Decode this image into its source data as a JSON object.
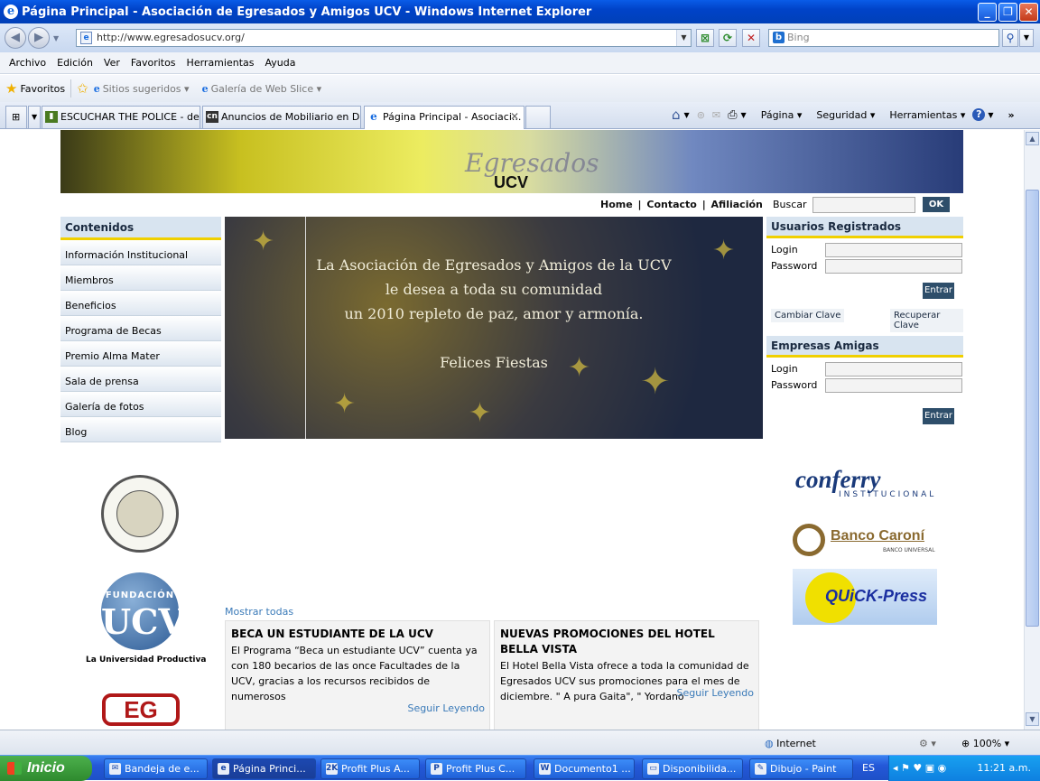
{
  "window": {
    "title": "Página Principal - Asociación de Egresados y Amigos UCV - Windows Internet Explorer"
  },
  "address": {
    "url": "http://www.egresadosucv.org/",
    "search_placeholder": "Bing"
  },
  "menu": [
    "Archivo",
    "Edición",
    "Ver",
    "Favoritos",
    "Herramientas",
    "Ayuda"
  ],
  "favorites": {
    "label": "Favoritos",
    "suggested": "Sitios sugeridos",
    "webslice": "Galería de Web Slice"
  },
  "tabs": [
    {
      "label": "ESCUCHAR THE POLICE - de ..."
    },
    {
      "label": "Anuncios de Mobiliario en Dis..."
    },
    {
      "label": "Página Principal - Asociaci..."
    }
  ],
  "commands": [
    "Página",
    "Seguridad",
    "Herramientas"
  ],
  "banner": {
    "logo_script": "Egresados",
    "logo_text": "UCV"
  },
  "toplinks": [
    "Home",
    "Contacto",
    "Afiliación"
  ],
  "search": {
    "label": "Buscar",
    "button": "OK"
  },
  "sidebar": {
    "title": "Contenidos",
    "items": [
      "Información Institucional",
      "Miembros",
      "Beneficios",
      "Programa de Becas",
      "Premio Alma Mater",
      "Sala de prensa",
      "Galería de fotos",
      "Blog"
    ]
  },
  "hero": {
    "lines": [
      "La Asociación de Egresados y Amigos de la UCV",
      "le desea a toda su comunidad",
      "un 2010 repleto de paz, amor y armonía."
    ],
    "closing": "Felices Fiestas"
  },
  "usuarios": {
    "title": "Usuarios Registrados",
    "login": "Login",
    "password": "Password",
    "button": "Entrar",
    "change": "Cambiar Clave",
    "recover": "Recuperar Clave"
  },
  "empresas": {
    "title": "Empresas Amigas",
    "login": "Login",
    "password": "Password",
    "button": "Entrar"
  },
  "logos": {
    "fundacion_top": "FUNDACIÓN",
    "fundacion_main": "UCV",
    "fundacion_caption": "La Universidad Productiva",
    "eg": "EG",
    "conferry": "conferry",
    "conferry_sub": "INSTITUCIONAL",
    "caroni": "Banco Caroní",
    "caroni_sub": "BANCO UNIVERSAL",
    "quick": "QUiCK-Press"
  },
  "news": {
    "show_all": "Mostrar todas",
    "items": [
      {
        "title": "BECA UN ESTUDIANTE DE LA UCV",
        "body": "El Programa “Beca un estudiante UCV” cuenta ya con 180 becarios de las once Facultades de la UCV, gracias a los recursos recibidos de numerosos",
        "more": "Seguir Leyendo"
      },
      {
        "title": "NUEVAS PROMOCIONES DEL HOTEL BELLA VISTA",
        "body": "El Hotel Bella Vista ofrece a toda la comunidad de Egresados UCV sus promociones para el mes de diciembre. \" A pura Gaita\", \" Yordano",
        "more": "Seguir Leyendo"
      }
    ]
  },
  "status": {
    "zone": "Internet",
    "zoom": "100%"
  },
  "taskbar": {
    "start": "Inicio",
    "items": [
      "Bandeja de e...",
      "Página Princi...",
      "Profit Plus A...",
      "Profit Plus C...",
      "Documento1 ...",
      "Disponibilida...",
      "Dibujo - Paint"
    ],
    "lang": "ES",
    "clock": "11:21 a.m."
  }
}
